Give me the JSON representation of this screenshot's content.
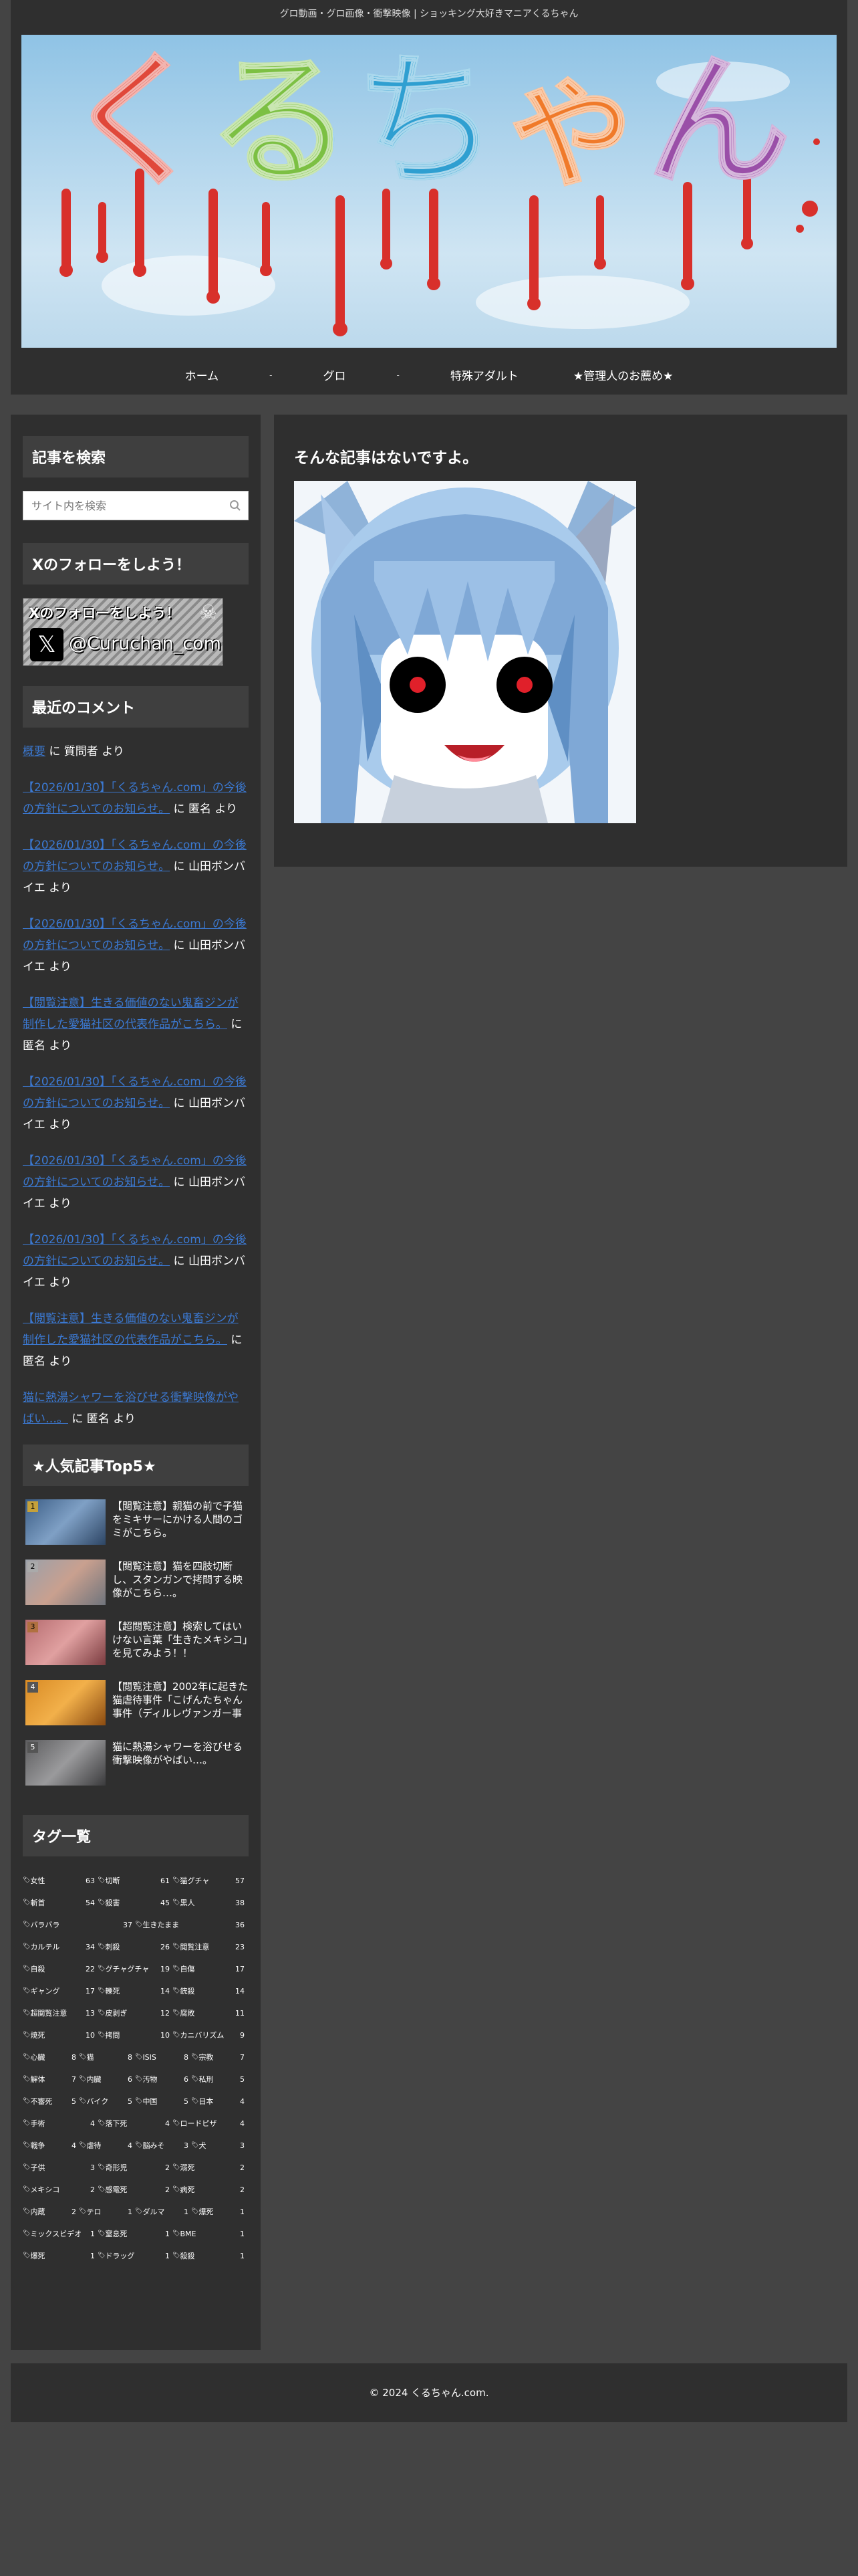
{
  "header": {
    "tagline": "グロ動画・グロ画像・衝撃映像 | ショッキング大好きマニアくるちゃん",
    "logo_text": "くるちゃん",
    "nav": [
      "ホーム",
      "グロ",
      "特殊アダルト",
      "★管理人のお薦め★"
    ]
  },
  "sidebar": {
    "search": {
      "title": "記事を検索",
      "placeholder": "サイト内を検索"
    },
    "follow": {
      "title": "Xのフォローをしよう！",
      "banner_lead": "Xのフォローをしよう！",
      "handle": "@Curuchan_com"
    },
    "recent_comments": {
      "title": "最近のコメント",
      "items": [
        {
          "link": "概要",
          "suffix": " に 質問者 より"
        },
        {
          "link": "【2026/01/30】「くるちゃん.com」の今後の方針についてのお知らせ。",
          "suffix": " に 匿名 より"
        },
        {
          "link": "【2026/01/30】「くるちゃん.com」の今後の方針についてのお知らせ。",
          "suffix": " に 山田ボンバイエ より"
        },
        {
          "link": "【2026/01/30】「くるちゃん.com」の今後の方針についてのお知らせ。",
          "suffix": " に 山田ボンバイエ より"
        },
        {
          "link": "【閲覧注意】生きる価値のない鬼畜ジンが制作した愛猫社区の代表作品がこちら。",
          "suffix": " に 匿名 より"
        },
        {
          "link": "【2026/01/30】「くるちゃん.com」の今後の方針についてのお知らせ。",
          "suffix": " に 山田ボンバイエ より"
        },
        {
          "link": "【2026/01/30】「くるちゃん.com」の今後の方針についてのお知らせ。",
          "suffix": " に 山田ボンバイエ より"
        },
        {
          "link": "【2026/01/30】「くるちゃん.com」の今後の方針についてのお知らせ。",
          "suffix": " に 山田ボンバイエ より"
        },
        {
          "link": "【閲覧注意】生きる価値のない鬼畜ジンが制作した愛猫社区の代表作品がこちら。",
          "suffix": " に 匿名 より"
        },
        {
          "link": "猫に熱湯シャワーを浴びせる衝撃映像がやばい…。",
          "suffix": " に 匿名 より"
        }
      ]
    },
    "popular": {
      "title": "★人気記事Top5★",
      "items": [
        {
          "rank": "1",
          "text": "【閲覧注意】親猫の前で子猫をミキサーにかける人間のゴミがこちら。",
          "color": "#4a6b8f"
        },
        {
          "rank": "2",
          "text": "【閲覧注意】猫を四肢切断し、スタンガンで拷問する映像がこちら…。",
          "color": "#8a8f98"
        },
        {
          "rank": "3",
          "text": "【超閲覧注意】検索してはいけない言葉「生きたメキシコ」を見てみよう！！",
          "color": "#a35a5f"
        },
        {
          "rank": "4",
          "text": "【閲覧注意】2002年に起きた猫虐待事件「こげんたちゃん事件（ディルレヴァンガー事件）」を知ってい…",
          "color": "#c7761c"
        },
        {
          "rank": "5",
          "text": "猫に熱湯シャワーを浴びせる衝撃映像がやばい…。",
          "color": "#6f6f70"
        }
      ]
    },
    "tags": {
      "title": "タグ一覧",
      "rows": [
        [
          [
            "女性",
            "63"
          ],
          [
            "切断",
            "61"
          ],
          [
            "猫グチャ",
            "57"
          ]
        ],
        [
          [
            "斬首",
            "54"
          ],
          [
            "殺害",
            "45"
          ],
          [
            "黒人",
            "38"
          ]
        ],
        [
          [
            "バラバラ",
            "37"
          ],
          [
            "生きたまま",
            "36"
          ]
        ],
        [
          [
            "カルテル",
            "34"
          ],
          [
            "刺殺",
            "26"
          ],
          [
            "閲覧注意",
            "23"
          ]
        ],
        [
          [
            "自殺",
            "22"
          ],
          [
            "グチャグチャ",
            "19"
          ],
          [
            "自傷",
            "17"
          ]
        ],
        [
          [
            "ギャング",
            "17"
          ],
          [
            "轢死",
            "14"
          ],
          [
            "銃殺",
            "14"
          ]
        ],
        [
          [
            "超閲覧注意",
            "13"
          ],
          [
            "皮剥ぎ",
            "12"
          ],
          [
            "腐敗",
            "11"
          ]
        ],
        [
          [
            "焼死",
            "10"
          ],
          [
            "拷問",
            "10"
          ],
          [
            "カニバリズム",
            "9"
          ]
        ],
        [
          [
            "心臓",
            "8"
          ],
          [
            "猫",
            "8"
          ],
          [
            "ISIS",
            "8"
          ],
          [
            "宗教",
            "7"
          ]
        ],
        [
          [
            "解体",
            "7"
          ],
          [
            "内臓",
            "6"
          ],
          [
            "汚物",
            "6"
          ],
          [
            "私刑",
            "5"
          ]
        ],
        [
          [
            "不審死",
            "5"
          ],
          [
            "バイク",
            "5"
          ],
          [
            "中国",
            "5"
          ],
          [
            "日本",
            "4"
          ]
        ],
        [
          [
            "手術",
            "4"
          ],
          [
            "落下死",
            "4"
          ],
          [
            "ロードピザ",
            "4"
          ]
        ],
        [
          [
            "戦争",
            "4"
          ],
          [
            "虐待",
            "4"
          ],
          [
            "脳みそ",
            "3"
          ],
          [
            "犬",
            "3"
          ]
        ],
        [
          [
            "子供",
            "3"
          ],
          [
            "奇形児",
            "2"
          ],
          [
            "溺死",
            "2"
          ]
        ],
        [
          [
            "メキシコ",
            "2"
          ],
          [
            "感電死",
            "2"
          ],
          [
            "病死",
            "2"
          ]
        ],
        [
          [
            "内蔵",
            "2"
          ],
          [
            "テロ",
            "1"
          ],
          [
            "ダルマ",
            "1"
          ],
          [
            "爆死",
            "1"
          ]
        ],
        [
          [
            "ミックスビデオ",
            "1"
          ],
          [
            "窒息死",
            "1"
          ],
          [
            "BME",
            "1"
          ]
        ],
        [
          [
            "爆死",
            "1"
          ],
          [
            "ドラッグ",
            "1"
          ],
          [
            "殺殺",
            "1"
          ]
        ]
      ]
    }
  },
  "main": {
    "heading": "そんな記事はないですよ。"
  },
  "footer": {
    "copyright": "© 2024 くるちゃん.com."
  },
  "colors": {
    "page_bg": "#444444",
    "panel_bg": "#2f2f2f",
    "widget_title_bg": "#3f3f3f",
    "link": "#3b78d0"
  }
}
